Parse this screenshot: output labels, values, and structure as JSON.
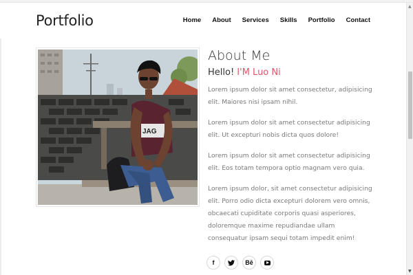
{
  "header": {
    "brand": "Portfolio",
    "nav": [
      "Home",
      "About",
      "Services",
      "Skills",
      "Portfolio",
      "Contact"
    ]
  },
  "about": {
    "title": "About Me",
    "hello_prefix": "Hello! ",
    "hello_name": "I'M Luo Ni",
    "paragraphs": [
      "Lorem ipsum dolor sit amet consectetur, adipisicing elit. Maiores nisi ipsam nihil.",
      "Lorem ipsum dolor sit amet consectetur adipisicing elit. Ut excepturi nobis dicta quos dolore!",
      "Lorem ipsum dolor sit amet consectetur adipisicing elit. Eos totam tempora optio magnam vero quia.",
      "Lorem ipsum dolor, sit amet consectetur adipisicing elit. Porro odio dicta excepturi dolorem vero omnis, obcaecati cupiditate corporis quasi asperiores, doloremque maxime repudiandae ullam consequatur ipsam sequi totam impedit enim!"
    ],
    "socials": [
      {
        "icon": "facebook-icon",
        "glyph": "f"
      },
      {
        "icon": "twitter-icon",
        "glyph": "🐦"
      },
      {
        "icon": "behance-icon",
        "glyph": "Bē"
      },
      {
        "icon": "youtube-icon",
        "glyph": ""
      }
    ]
  },
  "colors": {
    "accent": "#e0566b",
    "text": "#333333",
    "muted": "#7a7a7a"
  },
  "scrollbar": {
    "up_icon": "scroll-up-arrow-icon",
    "down_icon": "scroll-down-arrow-icon"
  }
}
